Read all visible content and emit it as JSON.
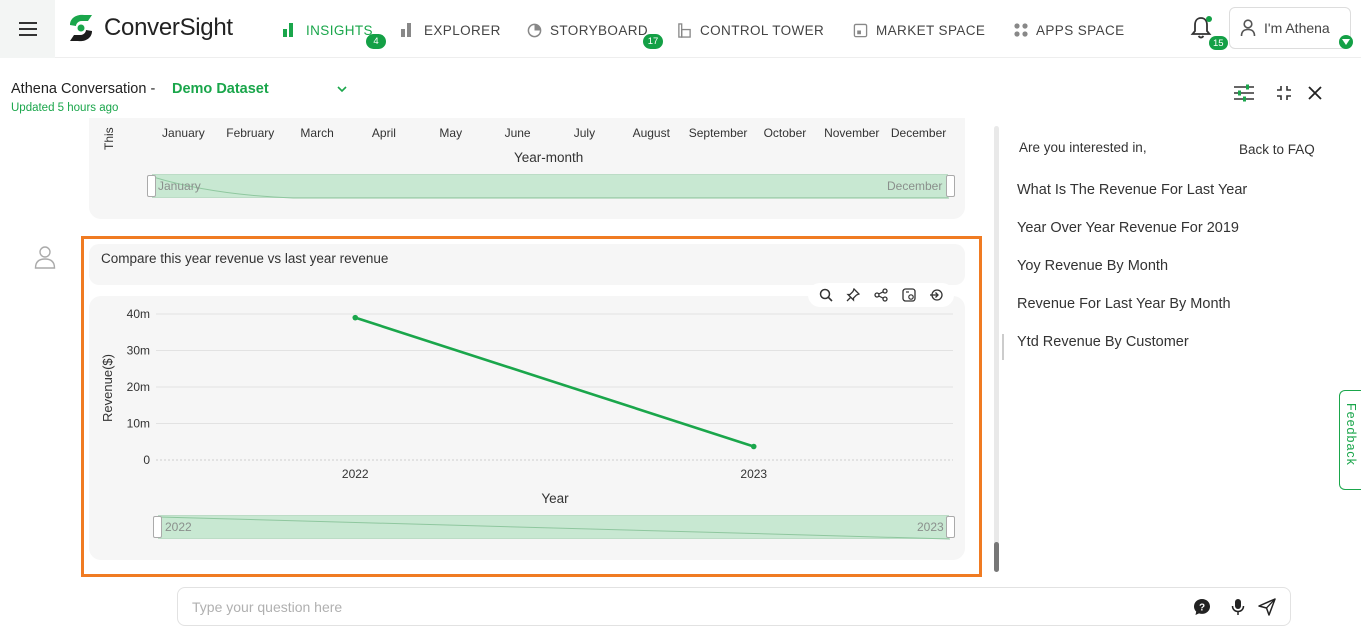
{
  "app": {
    "name": "ConverSight"
  },
  "nav": {
    "items": [
      {
        "label": "INSIGHTS",
        "badge": "4"
      },
      {
        "label": "EXPLORER"
      },
      {
        "label": "STORYBOARD",
        "badge": "17"
      },
      {
        "label": "CONTROL TOWER"
      },
      {
        "label": "MARKET SPACE"
      },
      {
        "label": "APPS SPACE"
      }
    ],
    "notifications_badge": "15",
    "user_label": "I'm Athena"
  },
  "colors": {
    "accent": "#1aa64b",
    "highlight": "#f07b22",
    "zoom_fill": "#c8e8d2"
  },
  "conversation": {
    "title": "Athena Conversation -",
    "dataset": "Demo Dataset",
    "updated": "Updated 5 hours ago"
  },
  "previous_chart": {
    "months": [
      "January",
      "February",
      "March",
      "April",
      "May",
      "June",
      "July",
      "August",
      "September",
      "October",
      "November",
      "December"
    ],
    "xlabel": "Year-month",
    "ylabel_partial": "This",
    "zoom_start": "January",
    "zoom_end": "December"
  },
  "question": "Compare this year revenue vs last year revenue",
  "chart_data": {
    "type": "line",
    "title": "",
    "x": [
      "2022",
      "2023"
    ],
    "series": [
      {
        "values": [
          39000000,
          3700000
        ]
      }
    ],
    "xlabel": "Year",
    "ylabel": "Revenue($)",
    "ylim": [
      0,
      40000000
    ],
    "yticks": [
      "0",
      "10m",
      "20m",
      "30m",
      "40m"
    ],
    "grid": true,
    "zoom_start": "2022",
    "zoom_end": "2023"
  },
  "faq": {
    "intro": "Are you interested in,",
    "back": "Back to FAQ",
    "items": [
      "What Is The Revenue For Last Year",
      "Year Over Year Revenue For 2019",
      "Yoy Revenue By Month",
      "Revenue For Last Year By Month",
      "Ytd Revenue By Customer"
    ]
  },
  "feedback": "Feedback",
  "input": {
    "placeholder": "Type your question here",
    "value": ""
  }
}
